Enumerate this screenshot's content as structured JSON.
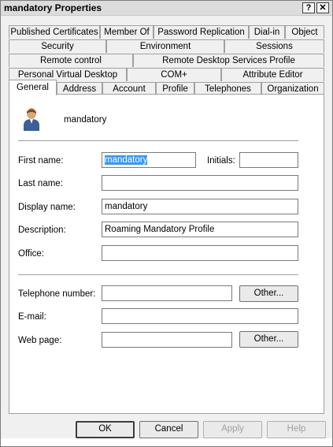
{
  "window": {
    "title": "mandatory Properties",
    "help_glyph": "?",
    "close_glyph": "✕"
  },
  "tabs": {
    "row1": [
      "Published Certificates",
      "Member Of",
      "Password Replication",
      "Dial-in",
      "Object"
    ],
    "row2": [
      "Security",
      "Environment",
      "Sessions"
    ],
    "row3": [
      "Remote control",
      "Remote Desktop Services Profile"
    ],
    "row4": [
      "Personal Virtual Desktop",
      "COM+",
      "Attribute Editor"
    ],
    "row5": [
      "General",
      "Address",
      "Account",
      "Profile",
      "Telephones",
      "Organization"
    ]
  },
  "general": {
    "user_icon": "user-icon",
    "display_header": "mandatory",
    "fields": {
      "first_name": {
        "label": "First name:",
        "value": "mandatory"
      },
      "initials": {
        "label": "Initials:",
        "value": ""
      },
      "last_name": {
        "label": "Last name:",
        "value": ""
      },
      "display_name": {
        "label": "Display name:",
        "value": "mandatory"
      },
      "description": {
        "label": "Description:",
        "value": "Roaming Mandatory Profile"
      },
      "office": {
        "label": "Office:",
        "value": ""
      },
      "telephone": {
        "label": "Telephone number:",
        "value": ""
      },
      "email": {
        "label": "E-mail:",
        "value": ""
      },
      "web_page": {
        "label": "Web page:",
        "value": ""
      }
    },
    "other_button": "Other..."
  },
  "buttons": {
    "ok": "OK",
    "cancel": "Cancel",
    "apply": "Apply",
    "help": "Help"
  }
}
